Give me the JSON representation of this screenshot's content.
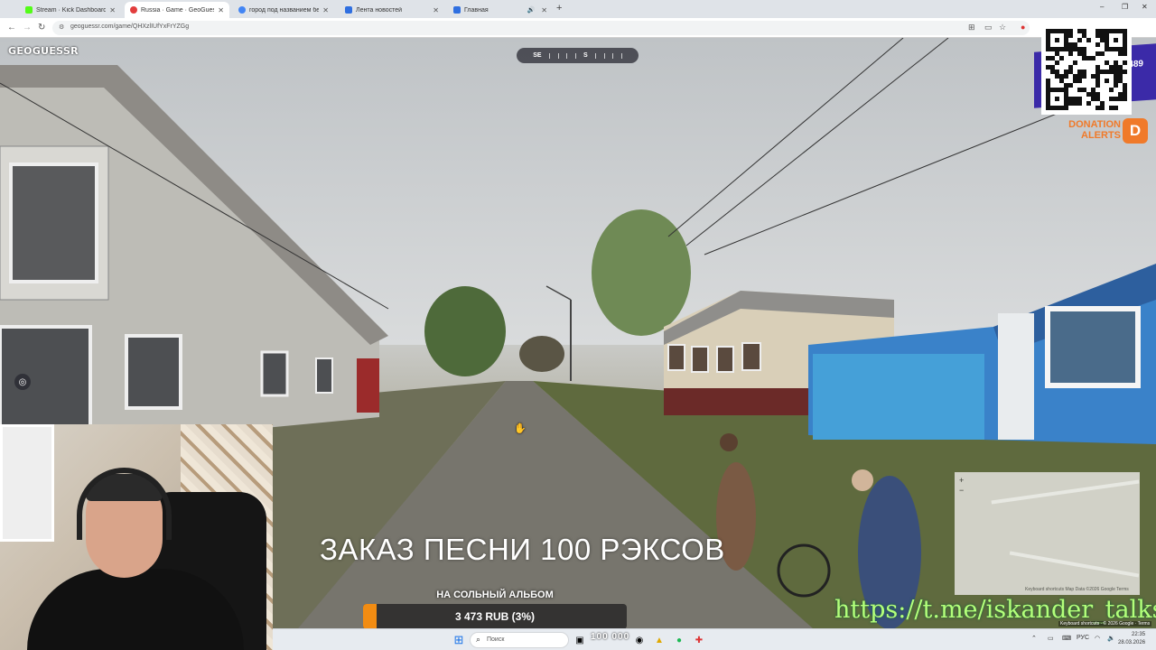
{
  "browser": {
    "tabs": [
      {
        "label": "Stream · Kick Dashboard",
        "color": "#53fc18",
        "active": false
      },
      {
        "label": "Russia · Game · GeoGuessr",
        "color": "#e23d3d",
        "active": true
      },
      {
        "label": "город под названием белон",
        "color": "#4285f4",
        "active": false
      },
      {
        "label": "Лента новостей",
        "color": "#2f6fe0",
        "active": false
      },
      {
        "label": "Главная",
        "color": "#2f6fe0",
        "active": false
      }
    ],
    "url": "geoguessr.com/game/QHXzlIUfYxFrYZGg",
    "new_tab": "+",
    "window_controls": [
      "–",
      "❐",
      "✕"
    ]
  },
  "game": {
    "logo": "GEOGUESSR",
    "compass": {
      "left": "SE",
      "right": "S"
    }
  },
  "overlay": {
    "donation": "DONATION ALERTS",
    "donation_icon": "D",
    "badge_number": "489",
    "song_request": "ЗАКАЗ ПЕСНИ 100 РЭКСОВ",
    "album_label": "НА СОЛЬНЫЙ АЛЬБОМ",
    "progress_text": "3 473 RUB (3%)",
    "progress_fraction": 0.03,
    "telegram": "https://t.me/iskander_talks",
    "map_footer": "Keyboard shortcuts   Map Data ©2026 Google   Terms",
    "kb_footer": "Keyboard shortcuts · © 2026 Google · Terms"
  },
  "taskbar": {
    "search_placeholder": "Поиск",
    "counter": "100 000",
    "lang": "РУС",
    "time": "22:35",
    "date": "28.03.2026"
  },
  "colors": {
    "accent": "#f28c12",
    "telegram_link": "#b3ff7a",
    "badge": "#3b2aa8"
  }
}
